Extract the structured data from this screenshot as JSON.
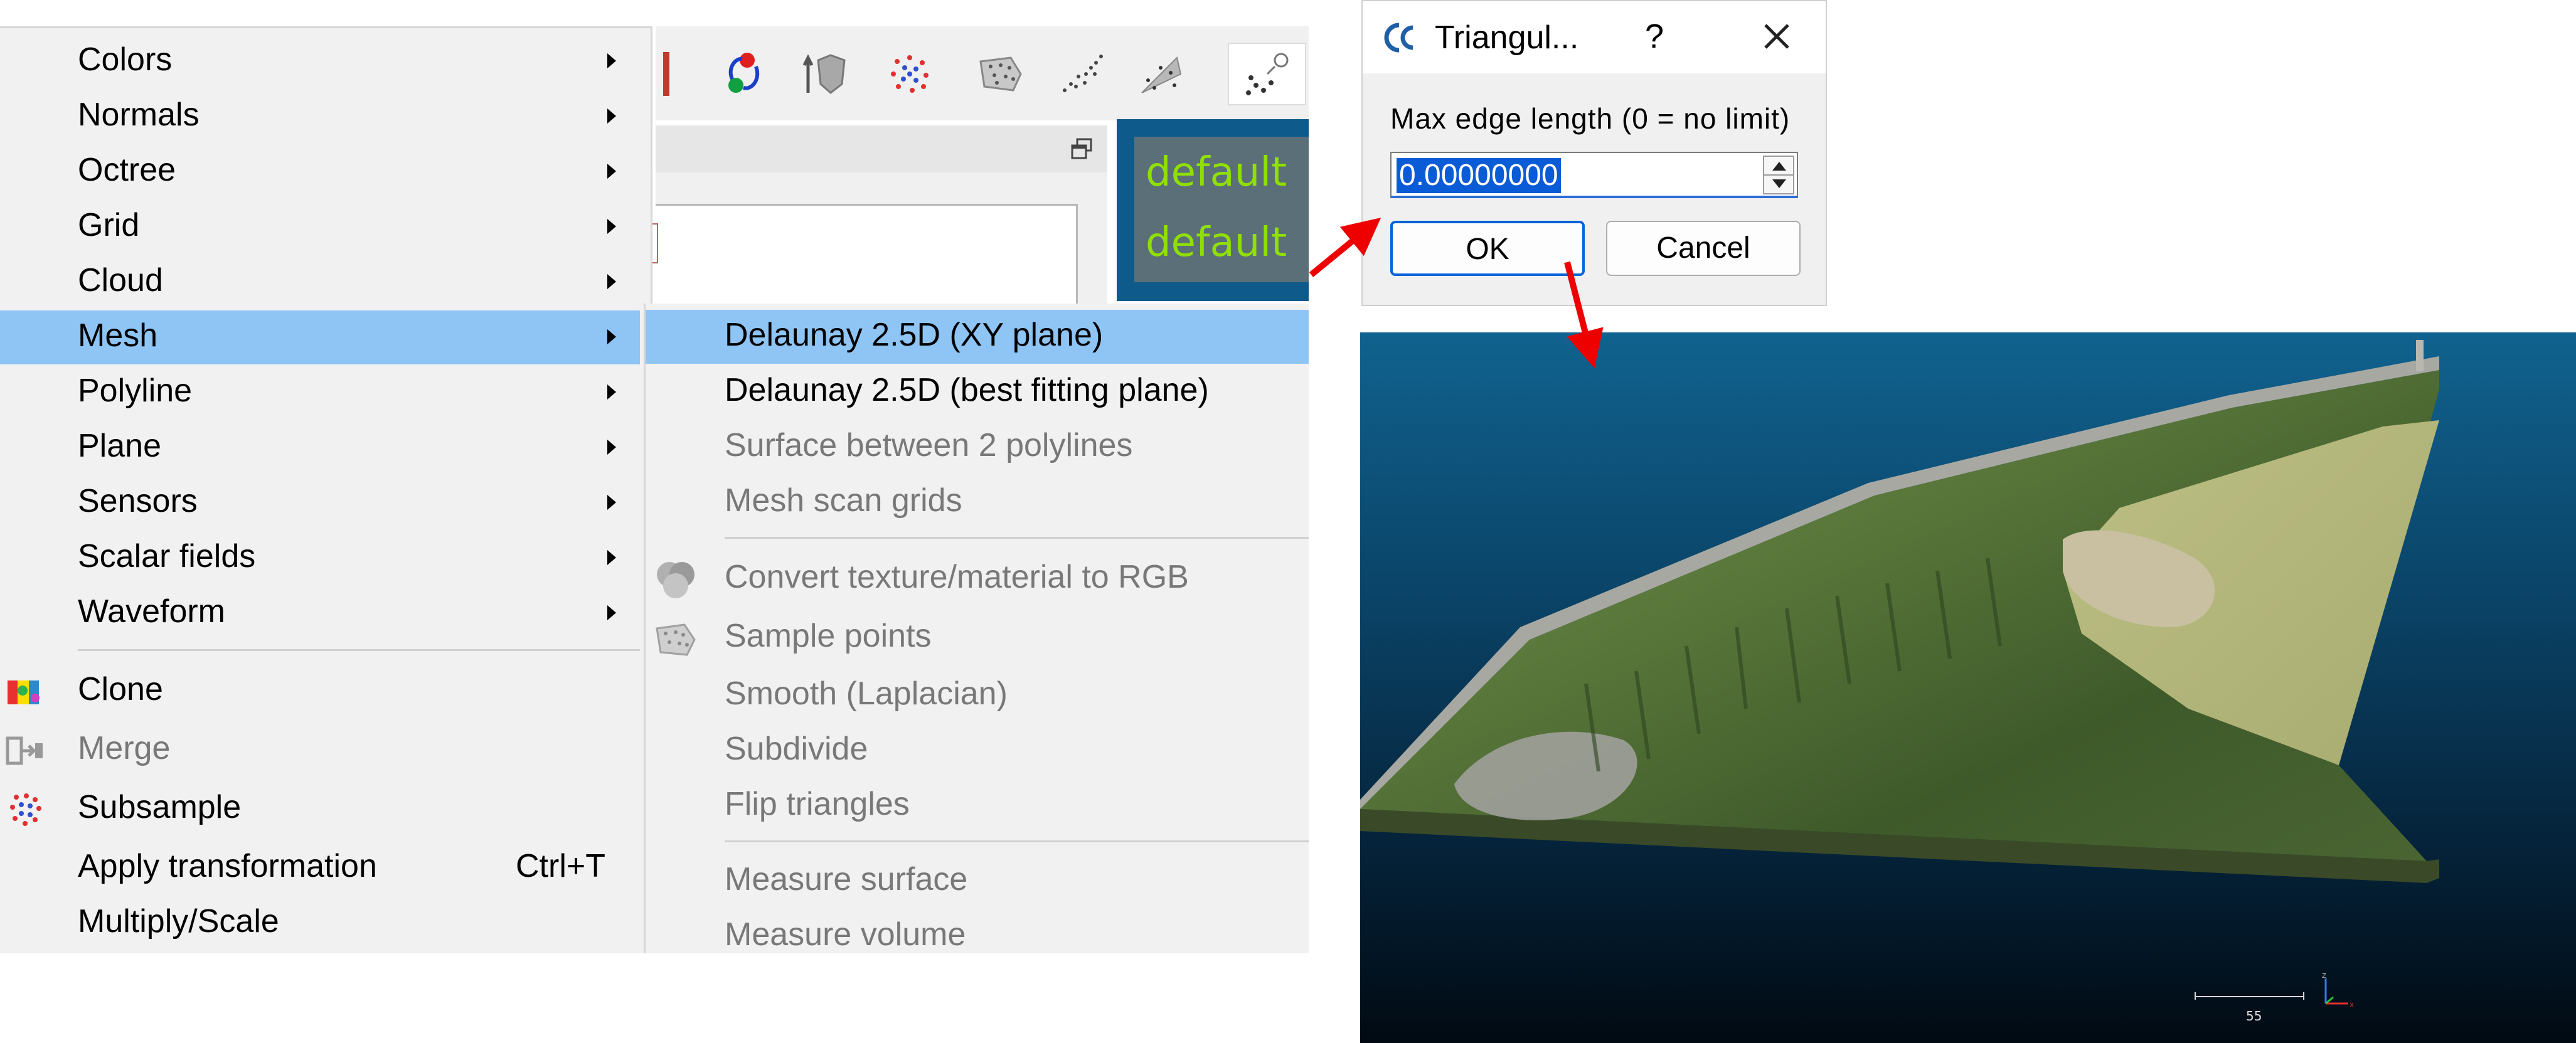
{
  "menu": {
    "items": [
      {
        "label": "Colors"
      },
      {
        "label": "Normals"
      },
      {
        "label": "Octree"
      },
      {
        "label": "Grid"
      },
      {
        "label": "Cloud"
      },
      {
        "label": "Mesh"
      },
      {
        "label": "Polyline"
      },
      {
        "label": "Plane"
      },
      {
        "label": "Sensors"
      },
      {
        "label": "Scalar fields"
      },
      {
        "label": "Waveform"
      },
      {
        "label": "Clone"
      },
      {
        "label": "Merge"
      },
      {
        "label": "Subsample"
      },
      {
        "label": "Apply transformation",
        "shortcut": "Ctrl+T"
      },
      {
        "label": "Multiply/Scale"
      }
    ]
  },
  "submenu": {
    "items": [
      {
        "label": "Delaunay 2.5D (XY plane)"
      },
      {
        "label": "Delaunay 2.5D (best fitting plane)"
      },
      {
        "label": "Surface between 2 polylines"
      },
      {
        "label": "Mesh scan grids"
      },
      {
        "label": "Convert texture/material to RGB"
      },
      {
        "label": "Sample points"
      },
      {
        "label": "Smooth (Laplacian)"
      },
      {
        "label": "Subdivide"
      },
      {
        "label": "Flip triangles"
      },
      {
        "label": "Measure surface"
      },
      {
        "label": "Measure volume"
      }
    ]
  },
  "background_app": {
    "default_labels": [
      "default",
      "default"
    ]
  },
  "dialog": {
    "title": "Triangul...",
    "help": "?",
    "field_label": "Max edge length (0 = no limit)",
    "field_value": "0.00000000",
    "ok_label": "OK",
    "cancel_label": "Cancel"
  },
  "view3d": {
    "scale_label": "55",
    "axis_labels": {
      "z": "Z",
      "x": "X"
    }
  },
  "annotations": {
    "arrow_color": "#ee0000"
  },
  "colors": {
    "highlight": "#8ec5f5",
    "selection": "#0a5bd6",
    "default_text": "#8fe000"
  }
}
